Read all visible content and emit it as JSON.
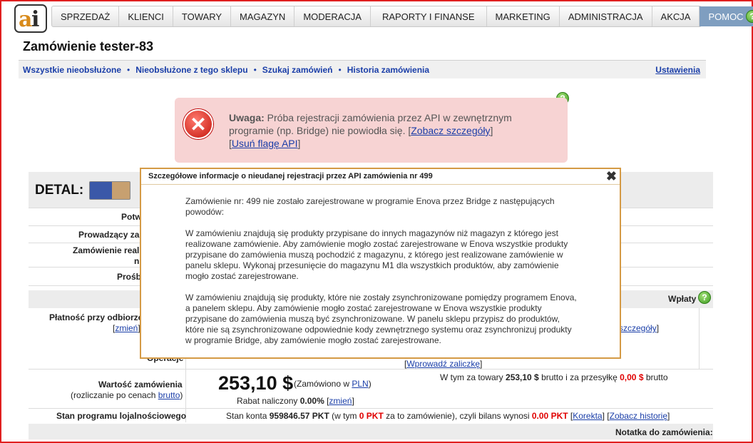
{
  "nav": {
    "items": [
      "SPRZEDAŻ",
      "KLIENCI",
      "TOWARY",
      "MAGAZYN",
      "MODERACJA",
      "RAPORTY I FINANSE",
      "MARKETING",
      "ADMINISTRACJA",
      "AKCJA"
    ],
    "help": "POMOC"
  },
  "page": {
    "title": "Zamówienie tester-83",
    "subnav": [
      "Wszystkie nieobsłużone",
      "Nieobsłużone z tego sklepu",
      "Szukaj zamówień",
      "Historia zamówienia"
    ],
    "settings": "Ustawienia"
  },
  "alert": {
    "strong": "Uwaga:",
    "message": " Próba rejestracji zamówienia przez API w zewnętrznym programie (np. Bridge) nie powiodła się. ",
    "link_details": "Zobacz szczegóły",
    "link_remove": "Usuń flagę API"
  },
  "detal": {
    "label": "DETAL:",
    "rows": [
      "Potw",
      "Prowadzący za",
      "Zamówienie real",
      "n",
      "Prośb"
    ]
  },
  "payments": {
    "wplaty": "Wpłaty",
    "platnosc": "Płatność przy odbiorze",
    "zmien": "zmień",
    "szczegoly": "szczegóły",
    "operacje": "Operacje",
    "zaliczke": "Wprowadź zaliczkę"
  },
  "order": {
    "value_label": "Wartość zamówienia",
    "value_sub": "(rozliczanie po cenach ",
    "brutto_link": "brutto",
    "price": "253,10 $",
    "ordered_in": "(Zamówiono w ",
    "currency_link": "PLN",
    "rabat_text": "Rabat naliczony ",
    "rabat_value": "0.00%",
    "rabat_link": "zmień",
    "w_tym": "W tym za towary ",
    "towary_val": "253,10 $",
    "brutto_mid": " brutto i za przesyłkę ",
    "przesylka_val": "0,00 $",
    "brutto_end": " brutto"
  },
  "loyalty": {
    "label": "Stan programu lojalnościowego",
    "stan_prefix": "Stan konta ",
    "stan_value": "959846.57 PKT",
    "w_tym": " (w tym ",
    "w_tym_value": "0 PKT",
    "za_to": " za to zamówienie), czyli bilans wynosi ",
    "bilans": "0.00 PKT",
    "korekta": "Korekta",
    "historia": "Zobacz historię"
  },
  "notatka": "Notatka do zamówienia:",
  "modal": {
    "title": "Szczegółowe informacje o nieudanej rejestracji przez API zamówienia nr 499",
    "close": "✖",
    "p1": "Zamówienie nr: 499 nie zostało zarejestrowane w programie Enova przez Bridge z następujących powodów:",
    "p2": "W zamówieniu znajdują się produkty przypisane do innych magazynów niż magazyn z którego jest realizowane zamówienie. Aby zamówienie mogło zostać zarejestrowane w Enova wszystkie produkty przypisane do zamówienia muszą pochodzić z magazynu, z którego jest realizowane zamówienie w panelu sklepu. Wykonaj przesunięcie do magazynu M1 dla wszystkich produktów, aby zamówienie mogło zostać zarejestrowane.",
    "p3": "W zamówieniu znajdują się produkty, które nie zostały zsynchronizowane pomiędzy programem Enova, a panelem sklepu. Aby zamówienie mogło zostać zarejestrowane w Enova wszystkie produkty przypisane do zamówienia muszą być zsynchronizowane. W panelu sklepu przypisz do produktów, które nie są zsynchronizowane odpowiednie kody zewnętrznego systemu oraz zsynchronizuj produkty w programie Bridge, aby zamówienie mogło zostać zarejestrowane."
  }
}
